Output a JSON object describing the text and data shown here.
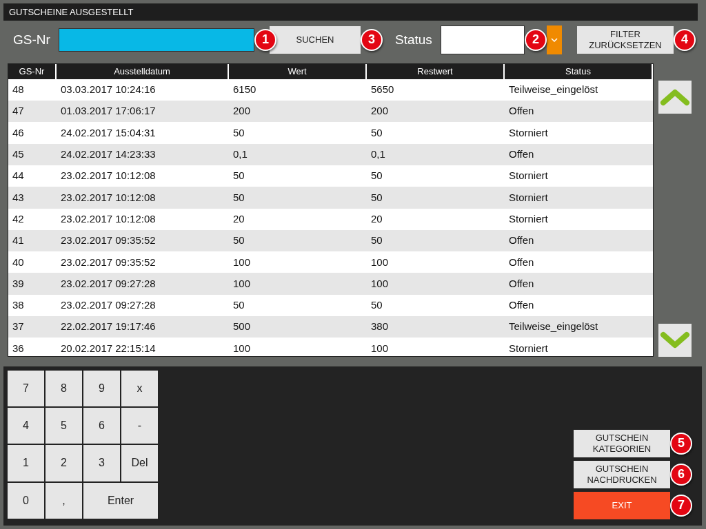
{
  "window": {
    "title": "GUTSCHEINE AUSGESTELLT"
  },
  "filter": {
    "gs_nr_label": "GS-Nr",
    "gs_nr_badge": "1",
    "search_button": {
      "label": "SUCHEN",
      "badge": "3"
    },
    "status_label": "Status",
    "status_badge": "2",
    "reset_button": {
      "label": "FILTER ZURÜCKSETZEN",
      "badge": "4"
    }
  },
  "table": {
    "columns": [
      "GS-Nr",
      "Ausstelldatum",
      "Wert",
      "Restwert",
      "Status"
    ],
    "rows": [
      [
        "48",
        "03.03.2017 10:24:16",
        "6150",
        "5650",
        "Teilweise_eingelöst"
      ],
      [
        "47",
        "01.03.2017 17:06:17",
        "200",
        "200",
        "Offen"
      ],
      [
        "46",
        "24.02.2017 15:04:31",
        "50",
        "50",
        "Storniert"
      ],
      [
        "45",
        "24.02.2017 14:23:33",
        "0,1",
        "0,1",
        "Offen"
      ],
      [
        "44",
        "23.02.2017 10:12:08",
        "50",
        "50",
        "Storniert"
      ],
      [
        "43",
        "23.02.2017 10:12:08",
        "50",
        "50",
        "Storniert"
      ],
      [
        "42",
        "23.02.2017 10:12:08",
        "20",
        "20",
        "Storniert"
      ],
      [
        "41",
        "23.02.2017 09:35:52",
        "50",
        "50",
        "Offen"
      ],
      [
        "40",
        "23.02.2017 09:35:52",
        "100",
        "100",
        "Offen"
      ],
      [
        "39",
        "23.02.2017 09:27:28",
        "100",
        "100",
        "Offen"
      ],
      [
        "38",
        "23.02.2017 09:27:28",
        "50",
        "50",
        "Offen"
      ],
      [
        "37",
        "22.02.2017 19:17:46",
        "500",
        "380",
        "Teilweise_eingelöst"
      ],
      [
        "36",
        "20.02.2017 22:15:14",
        "100",
        "100",
        "Storniert"
      ]
    ]
  },
  "keypad": [
    {
      "label": "7",
      "wide": false
    },
    {
      "label": "8",
      "wide": false
    },
    {
      "label": "9",
      "wide": false
    },
    {
      "label": "x",
      "wide": false
    },
    {
      "label": "4",
      "wide": false
    },
    {
      "label": "5",
      "wide": false
    },
    {
      "label": "6",
      "wide": false
    },
    {
      "label": "-",
      "wide": false
    },
    {
      "label": "1",
      "wide": false
    },
    {
      "label": "2",
      "wide": false
    },
    {
      "label": "3",
      "wide": false
    },
    {
      "label": "Del",
      "wide": false
    },
    {
      "label": "0",
      "wide": false
    },
    {
      "label": ",",
      "wide": false
    },
    {
      "label": "Enter",
      "wide": true
    }
  ],
  "actions": [
    {
      "label": "GUTSCHEIN KATEGORIEN",
      "badge": "5",
      "kind": "normal"
    },
    {
      "label": "GUTSCHEIN NACHDRUCKEN",
      "badge": "6",
      "kind": "normal"
    },
    {
      "label": "EXIT",
      "badge": "7",
      "kind": "danger"
    }
  ]
}
